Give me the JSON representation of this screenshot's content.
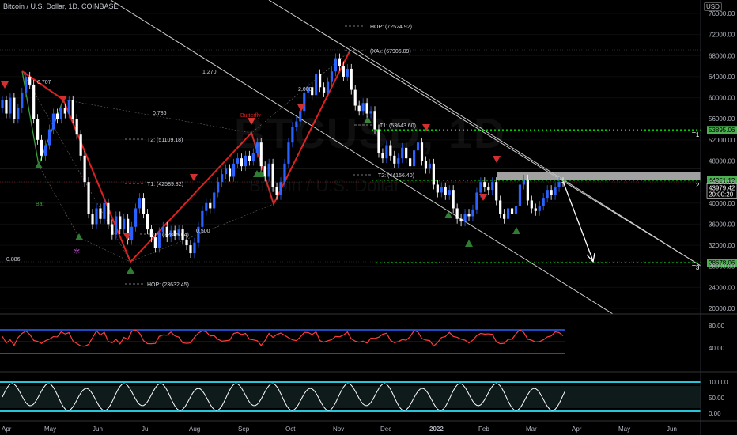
{
  "header": {
    "symbol": "Bitcoin / U.S. Dollar, 1D, COINBASE",
    "currency": "USD"
  },
  "watermark": {
    "big": "BTCUSD, 1D",
    "small": "Bitcoin / U.S. Dollar"
  },
  "chart_data": {
    "type": "candlestick",
    "price_axis": {
      "ticks": [
        76000,
        72000,
        68000,
        64000,
        60000,
        56000,
        52000,
        48000,
        44000,
        40000,
        36000,
        32000,
        28000,
        24000,
        20000
      ],
      "labels": [
        "76000.00",
        "72000.00",
        "68000.00",
        "64000.00",
        "60000.00",
        "56000.00",
        "52000.00",
        "48000.00",
        "44000.00",
        "40000.00",
        "36000.00",
        "32000.00",
        "28000.00",
        "24000.00",
        "20000.00"
      ],
      "range": [
        19000,
        77500
      ]
    },
    "time_axis": {
      "labels": [
        "Apr",
        "May",
        "Jun",
        "Jul",
        "Aug",
        "Sep",
        "Oct",
        "Nov",
        "Dec",
        "2022",
        "Feb",
        "Mar",
        "Apr",
        "May",
        "Jun"
      ]
    },
    "price_labels": [
      {
        "value": 53895,
        "text": "53895.06",
        "color": "#4caf50"
      },
      {
        "value": 44351,
        "text": "44351.13",
        "color": "#4caf50"
      },
      {
        "value": 43979,
        "text": "43979.42",
        "sub": "20:00:20",
        "color": "#ffffff"
      },
      {
        "value": 28678,
        "text": "28678.06",
        "color": "#4caf50"
      }
    ],
    "targets": [
      {
        "name": "T1",
        "value": 53895
      },
      {
        "name": "T2",
        "value": 44351
      },
      {
        "name": "T3",
        "value": 28678
      }
    ],
    "annotations": [
      {
        "text": "HOP: (72524.92)",
        "value": 72525
      },
      {
        "text": "(XA): (67906.09)",
        "value": 67906
      },
      {
        "text": "T1: (53643.60)",
        "value": 53644
      },
      {
        "text": "T2: (44156.40)",
        "value": 44156
      },
      {
        "text": "T2: (51109.18)",
        "value": 51109
      },
      {
        "text": "T1: (42589.82)",
        "value": 42590
      },
      {
        "text": "(32855.04)",
        "value": 32855
      },
      {
        "text": "HOP: (23632.45)",
        "value": 23632
      },
      {
        "text": "0.707",
        "value": 62100
      },
      {
        "text": "1.270",
        "value": 64900
      },
      {
        "text": "0.786",
        "value": 56800
      },
      {
        "text": "2.000",
        "value": 60700
      },
      {
        "text": "0.500",
        "value": 34300
      },
      {
        "text": "0.886",
        "value": 29700
      },
      {
        "text": "Butterfly",
        "value": 56300
      },
      {
        "text": "Bat",
        "value": 39900
      }
    ],
    "candles": [
      {
        "o": 58000,
        "c": 59500
      },
      {
        "o": 59500,
        "c": 57000
      },
      {
        "o": 57000,
        "c": 60000
      },
      {
        "o": 60000,
        "c": 56000
      },
      {
        "o": 56000,
        "c": 58000
      },
      {
        "o": 58000,
        "c": 61000
      },
      {
        "o": 61000,
        "c": 64000
      },
      {
        "o": 64000,
        "c": 62500
      },
      {
        "o": 62500,
        "c": 56000
      },
      {
        "o": 56000,
        "c": 52000
      },
      {
        "o": 52000,
        "c": 49000
      },
      {
        "o": 49000,
        "c": 51000
      },
      {
        "o": 51000,
        "c": 54000
      },
      {
        "o": 54000,
        "c": 57000
      },
      {
        "o": 57000,
        "c": 56000
      },
      {
        "o": 56000,
        "c": 58000
      },
      {
        "o": 58000,
        "c": 57000
      },
      {
        "o": 57000,
        "c": 59500
      },
      {
        "o": 59500,
        "c": 56000
      },
      {
        "o": 56000,
        "c": 53000
      },
      {
        "o": 53000,
        "c": 49000
      },
      {
        "o": 49000,
        "c": 44000
      },
      {
        "o": 44000,
        "c": 38000
      },
      {
        "o": 38000,
        "c": 36000
      },
      {
        "o": 36000,
        "c": 39000
      },
      {
        "o": 39000,
        "c": 37000
      },
      {
        "o": 37000,
        "c": 40000
      },
      {
        "o": 40000,
        "c": 36000
      },
      {
        "o": 36000,
        "c": 34000
      },
      {
        "o": 34000,
        "c": 37500
      },
      {
        "o": 37500,
        "c": 35000
      },
      {
        "o": 35000,
        "c": 37000
      },
      {
        "o": 37000,
        "c": 33000
      },
      {
        "o": 33000,
        "c": 35500
      },
      {
        "o": 35500,
        "c": 39000
      },
      {
        "o": 39000,
        "c": 41000
      },
      {
        "o": 41000,
        "c": 38000
      },
      {
        "o": 38000,
        "c": 35000
      },
      {
        "o": 35000,
        "c": 33500
      },
      {
        "o": 33500,
        "c": 31500
      },
      {
        "o": 31500,
        "c": 34500
      },
      {
        "o": 34500,
        "c": 35500
      },
      {
        "o": 35500,
        "c": 33500
      },
      {
        "o": 33500,
        "c": 34800
      },
      {
        "o": 34800,
        "c": 33800
      },
      {
        "o": 33800,
        "c": 35000
      },
      {
        "o": 35000,
        "c": 33000
      },
      {
        "o": 33000,
        "c": 32000
      },
      {
        "o": 32000,
        "c": 30500
      },
      {
        "o": 30500,
        "c": 32500
      },
      {
        "o": 32500,
        "c": 35500
      },
      {
        "o": 35500,
        "c": 38500
      },
      {
        "o": 38500,
        "c": 40000
      },
      {
        "o": 40000,
        "c": 39000
      },
      {
        "o": 39000,
        "c": 42000
      },
      {
        "o": 42000,
        "c": 44000
      },
      {
        "o": 44000,
        "c": 45500
      },
      {
        "o": 45500,
        "c": 46500
      },
      {
        "o": 46500,
        "c": 45000
      },
      {
        "o": 45000,
        "c": 47500
      },
      {
        "o": 47500,
        "c": 48500
      },
      {
        "o": 48500,
        "c": 47000
      },
      {
        "o": 47000,
        "c": 49000
      },
      {
        "o": 49000,
        "c": 48000
      },
      {
        "o": 48000,
        "c": 49500
      },
      {
        "o": 49500,
        "c": 51500
      },
      {
        "o": 51500,
        "c": 47000
      },
      {
        "o": 47000,
        "c": 45000
      },
      {
        "o": 45000,
        "c": 47500
      },
      {
        "o": 47500,
        "c": 43000
      },
      {
        "o": 43000,
        "c": 41500
      },
      {
        "o": 41500,
        "c": 44000
      },
      {
        "o": 44000,
        "c": 47500
      },
      {
        "o": 47500,
        "c": 51500
      },
      {
        "o": 51500,
        "c": 54500
      },
      {
        "o": 54500,
        "c": 55500
      },
      {
        "o": 55500,
        "c": 57500
      },
      {
        "o": 57500,
        "c": 61000
      },
      {
        "o": 61000,
        "c": 62000
      },
      {
        "o": 62000,
        "c": 60500
      },
      {
        "o": 60500,
        "c": 64500
      },
      {
        "o": 64500,
        "c": 62000
      },
      {
        "o": 62000,
        "c": 61000
      },
      {
        "o": 61000,
        "c": 63000
      },
      {
        "o": 63000,
        "c": 65000
      },
      {
        "o": 65000,
        "c": 67500
      },
      {
        "o": 67500,
        "c": 66000
      },
      {
        "o": 66000,
        "c": 64000
      },
      {
        "o": 64000,
        "c": 65500
      },
      {
        "o": 65500,
        "c": 61500
      },
      {
        "o": 61500,
        "c": 58500
      },
      {
        "o": 58500,
        "c": 57500
      },
      {
        "o": 57500,
        "c": 59000
      },
      {
        "o": 59000,
        "c": 57000
      },
      {
        "o": 57000,
        "c": 57500
      },
      {
        "o": 57500,
        "c": 54000
      },
      {
        "o": 54000,
        "c": 49500
      },
      {
        "o": 49500,
        "c": 48500
      },
      {
        "o": 48500,
        "c": 51000
      },
      {
        "o": 51000,
        "c": 49000
      },
      {
        "o": 49000,
        "c": 47500
      },
      {
        "o": 47500,
        "c": 48500
      },
      {
        "o": 48500,
        "c": 50500
      },
      {
        "o": 50500,
        "c": 48500
      },
      {
        "o": 48500,
        "c": 47000
      },
      {
        "o": 47000,
        "c": 50000
      },
      {
        "o": 50000,
        "c": 51500
      },
      {
        "o": 51500,
        "c": 48000
      },
      {
        "o": 48000,
        "c": 46500
      },
      {
        "o": 46500,
        "c": 47500
      },
      {
        "o": 47500,
        "c": 43500
      },
      {
        "o": 43500,
        "c": 42000
      },
      {
        "o": 42000,
        "c": 43000
      },
      {
        "o": 43000,
        "c": 41500
      },
      {
        "o": 41500,
        "c": 42500
      },
      {
        "o": 42500,
        "c": 39000
      },
      {
        "o": 39000,
        "c": 37000
      },
      {
        "o": 37000,
        "c": 36500
      },
      {
        "o": 36500,
        "c": 38000
      },
      {
        "o": 38000,
        "c": 37500
      },
      {
        "o": 37500,
        "c": 38800
      },
      {
        "o": 38800,
        "c": 42000
      },
      {
        "o": 42000,
        "c": 44000
      },
      {
        "o": 44000,
        "c": 43000
      },
      {
        "o": 43000,
        "c": 42500
      },
      {
        "o": 42500,
        "c": 44000
      },
      {
        "o": 44000,
        "c": 40500
      },
      {
        "o": 40500,
        "c": 38000
      },
      {
        "o": 38000,
        "c": 37000
      },
      {
        "o": 37000,
        "c": 39000
      },
      {
        "o": 39000,
        "c": 38000
      },
      {
        "o": 38000,
        "c": 39500
      },
      {
        "o": 39500,
        "c": 43500
      },
      {
        "o": 43500,
        "c": 44500
      },
      {
        "o": 44500,
        "c": 40500
      },
      {
        "o": 40500,
        "c": 39000
      },
      {
        "o": 39000,
        "c": 38500
      },
      {
        "o": 38500,
        "c": 39500
      },
      {
        "o": 39500,
        "c": 41000
      },
      {
        "o": 41000,
        "c": 42500
      },
      {
        "o": 42500,
        "c": 41500
      },
      {
        "o": 41500,
        "c": 43000
      },
      {
        "o": 43000,
        "c": 44000
      },
      {
        "o": 44000,
        "c": 43979
      }
    ]
  },
  "rsi": {
    "labels": [
      "80.00",
      "40.00"
    ]
  },
  "stoch": {
    "labels": [
      "100.00",
      "50.00",
      "0.00"
    ]
  }
}
